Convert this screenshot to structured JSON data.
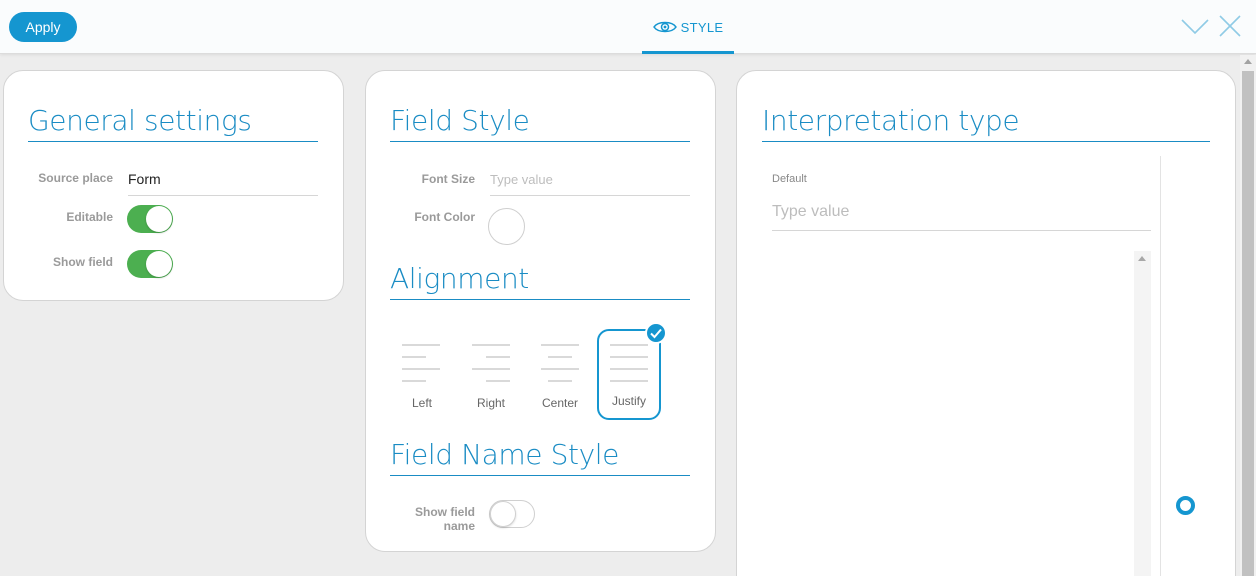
{
  "header": {
    "apply_label": "Apply",
    "tab_label": "STYLE",
    "accent": "#1596d0"
  },
  "general": {
    "title": "General settings",
    "source_place_label": "Source place",
    "source_place_value": "Form",
    "editable_label": "Editable",
    "editable_on": true,
    "show_field_label": "Show field",
    "show_field_on": true
  },
  "field_style": {
    "title": "Field Style",
    "font_size_label": "Font Size",
    "font_size_placeholder": "Type value",
    "font_color_label": "Font Color"
  },
  "alignment": {
    "title": "Alignment",
    "options": [
      "Left",
      "Right",
      "Center",
      "Justify"
    ],
    "selected": "Justify"
  },
  "field_name_style": {
    "title": "Field Name Style",
    "show_field_name_line1": "Show field",
    "show_field_name_line2": "name",
    "show_field_name_on": false
  },
  "interpretation": {
    "title": "Interpretation type",
    "default_label": "Default",
    "default_placeholder": "Type value"
  }
}
